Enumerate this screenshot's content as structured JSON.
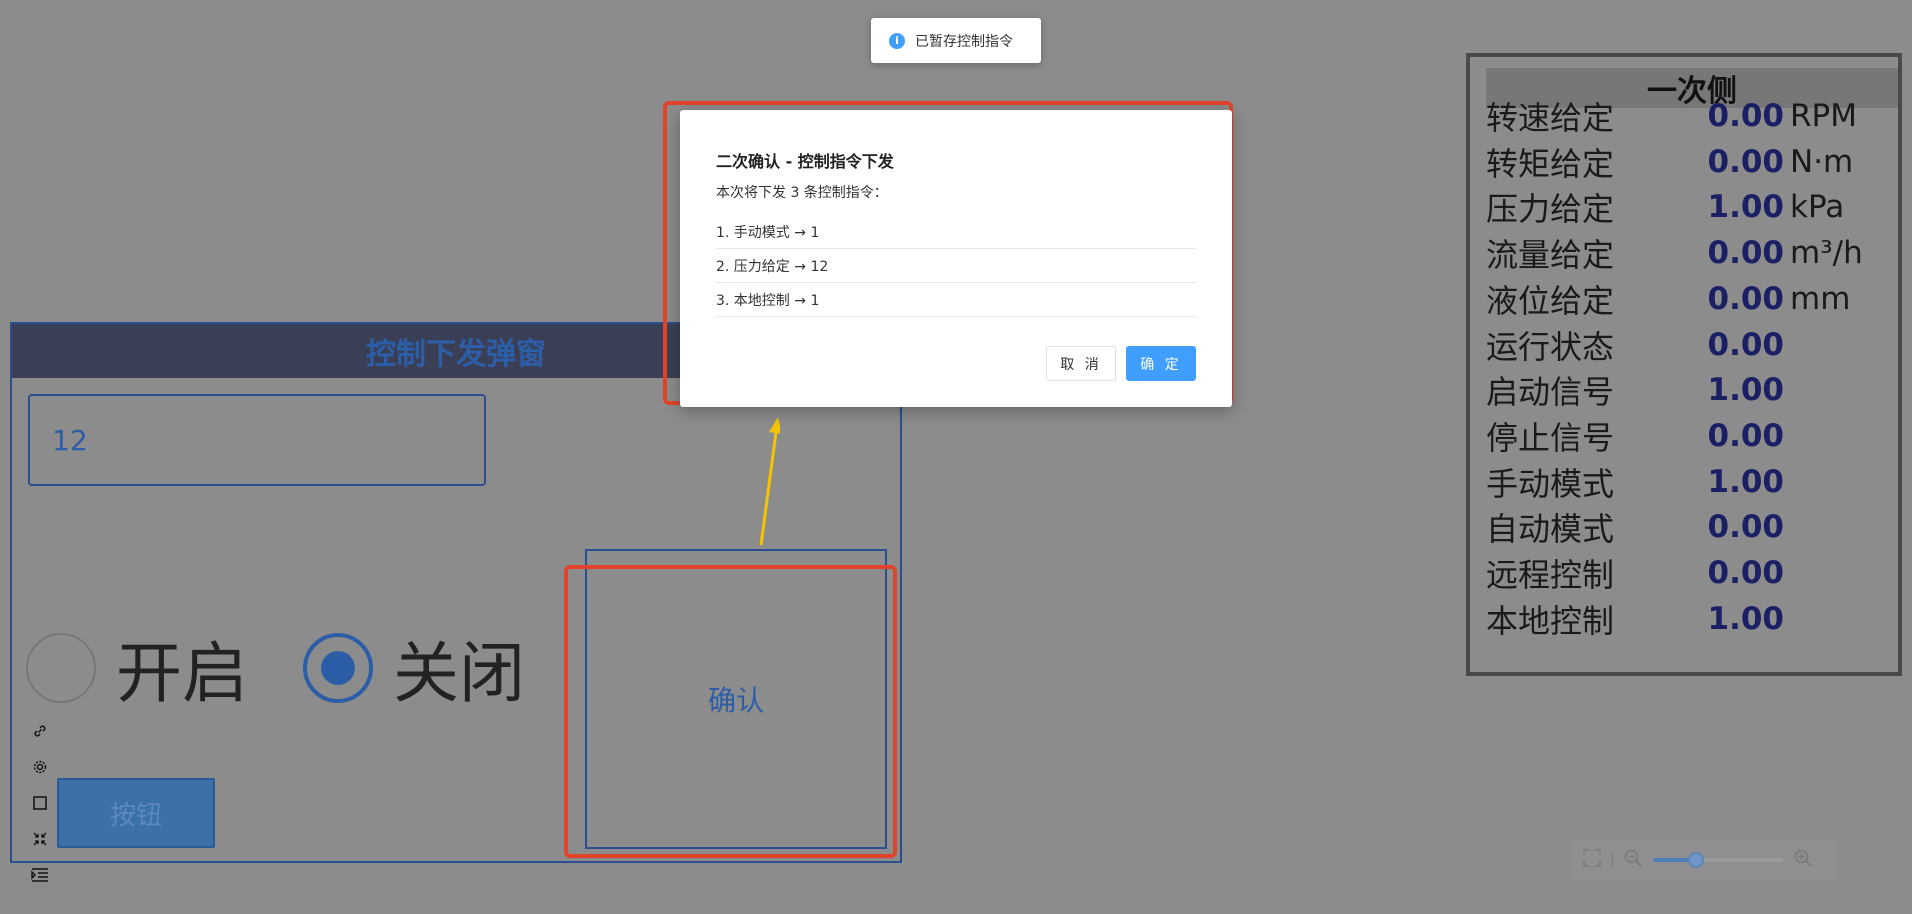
{
  "toast": {
    "message": "已暂存控制指令"
  },
  "control_panel": {
    "title": "控制下发弹窗",
    "input_value": "12",
    "radio_on_label": "开启",
    "radio_off_label": "关闭",
    "selected": "关闭",
    "confirm_label": "确认",
    "button_label": "按钮"
  },
  "dialog": {
    "title": "二次确认 - 控制指令下发",
    "description": "本次将下发 3 条控制指令：",
    "items": [
      "1. 手动模式 → 1",
      "2. 压力给定 → 12",
      "3. 本地控制 → 1"
    ],
    "cancel_label": "取 消",
    "ok_label": "确 定"
  },
  "params": {
    "title": "一次侧",
    "rows": [
      {
        "label": "转速给定",
        "value": "0.00",
        "unit": "RPM"
      },
      {
        "label": "转矩给定",
        "value": "0.00",
        "unit": "N·m"
      },
      {
        "label": "压力给定",
        "value": "1.00",
        "unit": "kPa"
      },
      {
        "label": "流量给定",
        "value": "0.00",
        "unit": "m³/h"
      },
      {
        "label": "液位给定",
        "value": "0.00",
        "unit": "mm"
      },
      {
        "label": "运行状态",
        "value": "0.00",
        "unit": ""
      },
      {
        "label": "启动信号",
        "value": "1.00",
        "unit": ""
      },
      {
        "label": "停止信号",
        "value": "0.00",
        "unit": ""
      },
      {
        "label": "手动模式",
        "value": "1.00",
        "unit": ""
      },
      {
        "label": "自动模式",
        "value": "0.00",
        "unit": ""
      },
      {
        "label": "远程控制",
        "value": "0.00",
        "unit": ""
      },
      {
        "label": "本地控制",
        "value": "1.00",
        "unit": ""
      }
    ]
  },
  "zoom": {
    "level_fraction": 0.33
  },
  "colors": {
    "accent": "#409eff",
    "annotation_red": "#e1442a",
    "annotation_arrow": "#f5c400"
  }
}
